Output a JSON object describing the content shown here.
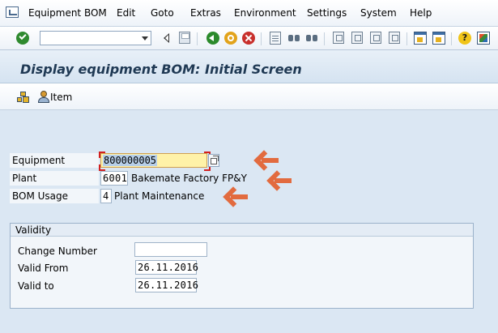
{
  "menu": {
    "items": [
      "Equipment BOM",
      "Edit",
      "Goto",
      "Extras",
      "Environment",
      "Settings",
      "System",
      "Help"
    ]
  },
  "toolbar": {
    "command_field": "",
    "icons": [
      "enter-icon",
      "back-arrow-icon",
      "save-icon",
      "back-icon",
      "exit-icon",
      "cancel-icon",
      "print-icon",
      "find-icon",
      "find-next-icon",
      "first-page-icon",
      "previous-page-icon",
      "next-page-icon",
      "last-page-icon",
      "new-session-icon",
      "shortcut-icon",
      "help-icon",
      "layout-icon"
    ]
  },
  "title": "Display equipment BOM: Initial Screen",
  "app_toolbar": {
    "item_label": "Item"
  },
  "form": {
    "equipment_label": "Equipment",
    "equipment_value": "800000005",
    "plant_label": "Plant",
    "plant_value": "6001",
    "plant_desc": "Bakemate Factory FP&Y",
    "bom_usage_label": "BOM Usage",
    "bom_usage_value": "4",
    "bom_usage_desc": "Plant Maintenance"
  },
  "validity": {
    "title": "Validity",
    "change_number_label": "Change Number",
    "change_number_value": "",
    "valid_from_label": "Valid From",
    "valid_from_value": "26.11.2016",
    "valid_to_label": "Valid to",
    "valid_to_value": "26.11.2016"
  },
  "colors": {
    "annotation_arrow": "#e26b3f",
    "required_field": "#fff2a8",
    "title_text": "#1f3954"
  }
}
